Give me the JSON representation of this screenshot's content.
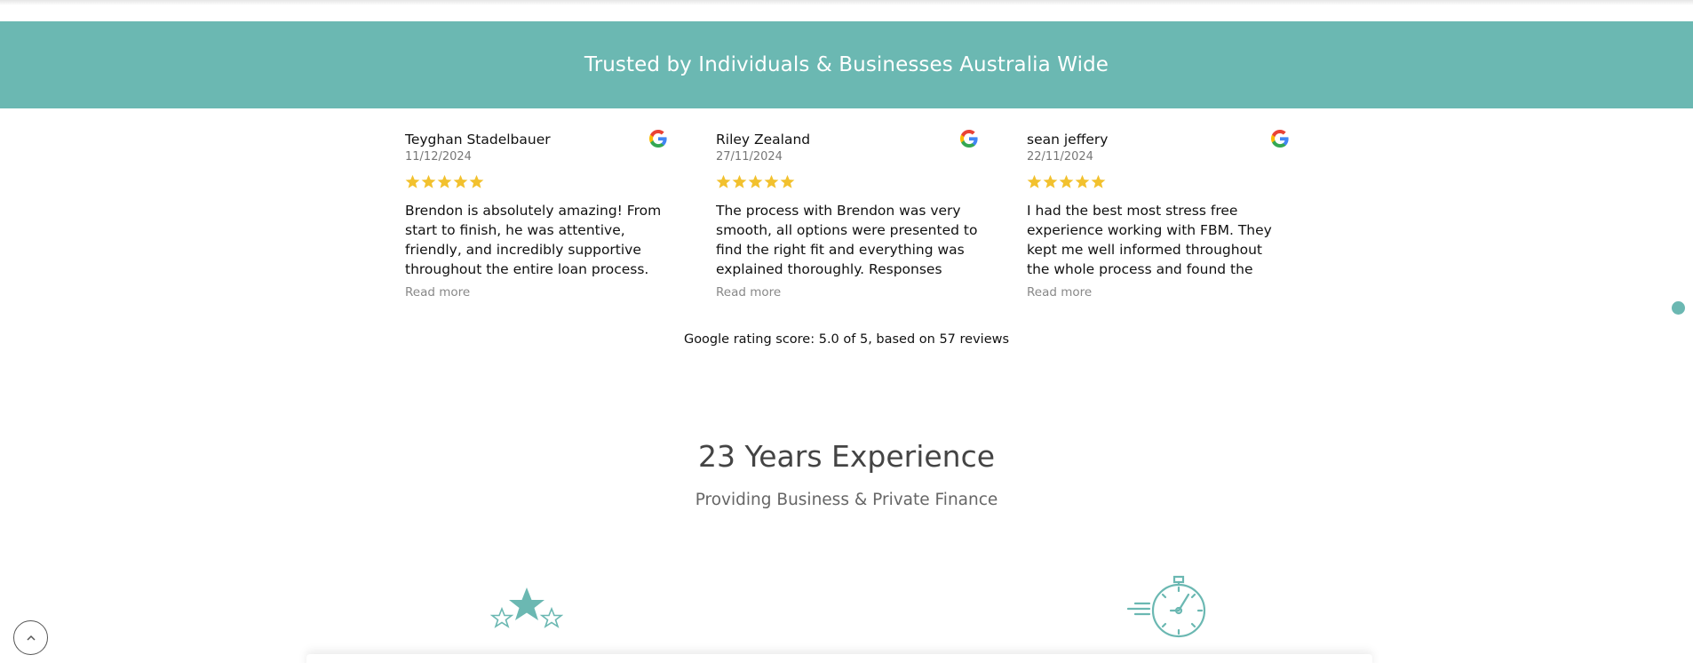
{
  "banner": {
    "title": "Trusted by Individuals & Businesses Australia Wide"
  },
  "reviews": [
    {
      "name": "Teyghan Stadelbauer",
      "date": "11/12/2024",
      "rating": 5,
      "text": "Brendon is absolutely amazing! From start to finish, he was attentive, friendly, and incredibly supportive throughout the entire loan process. H...",
      "read_more": "Read more"
    },
    {
      "name": "Riley Zealand",
      "date": "27/11/2024",
      "rating": 5,
      "text": "The process with Brendon was very smooth, all options were presented to find the right fit and everything was explained thoroughly. Responses wer...",
      "read_more": "Read more"
    },
    {
      "name": "sean jeffery",
      "date": "22/11/2024",
      "rating": 5,
      "text": "I had the best most stress free experience working with FBM. They kept me well informed throughout the whole process and found the best...",
      "read_more": "Read more"
    }
  ],
  "rating_summary": "Google rating score: 5.0 of 5, based on 57 reviews",
  "experience": {
    "title": "23 Years Experience",
    "subtitle": "Providing Business & Private Finance"
  },
  "icons": {
    "review_source": "google-g-icon",
    "rating_star": "star-icon",
    "feature_1": "star-group-icon",
    "feature_2": "stopwatch-icon",
    "scroll_top": "chevron-up-icon"
  },
  "colors": {
    "accent": "#6bb8b2",
    "star": "#f2c12e",
    "text": "#111111",
    "muted": "#888888"
  }
}
